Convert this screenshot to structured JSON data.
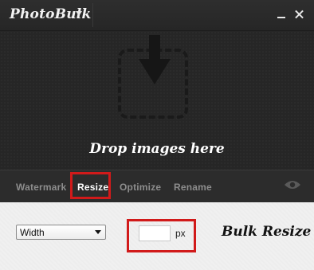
{
  "app": {
    "logo_text": "PhotoBulk"
  },
  "dropzone": {
    "text": "Drop images here"
  },
  "tabs": [
    {
      "label": "Watermark"
    },
    {
      "label": "Resize"
    },
    {
      "label": "Optimize"
    },
    {
      "label": "Rename"
    }
  ],
  "active_tab": "Resize",
  "resize": {
    "mode_selected": "Width",
    "size_value": "",
    "unit": "px",
    "title": "Bulk Resize"
  },
  "icons": {
    "title_menu": "chevron-down-icon",
    "minimize": "minimize-icon",
    "close": "close-icon",
    "drop": "download-arrow-icon",
    "preview": "eye-icon"
  },
  "colors": {
    "highlight": "#d11a1a",
    "active_tab_text": "#ffffff",
    "inactive_tab_text": "#8d8d8d"
  }
}
